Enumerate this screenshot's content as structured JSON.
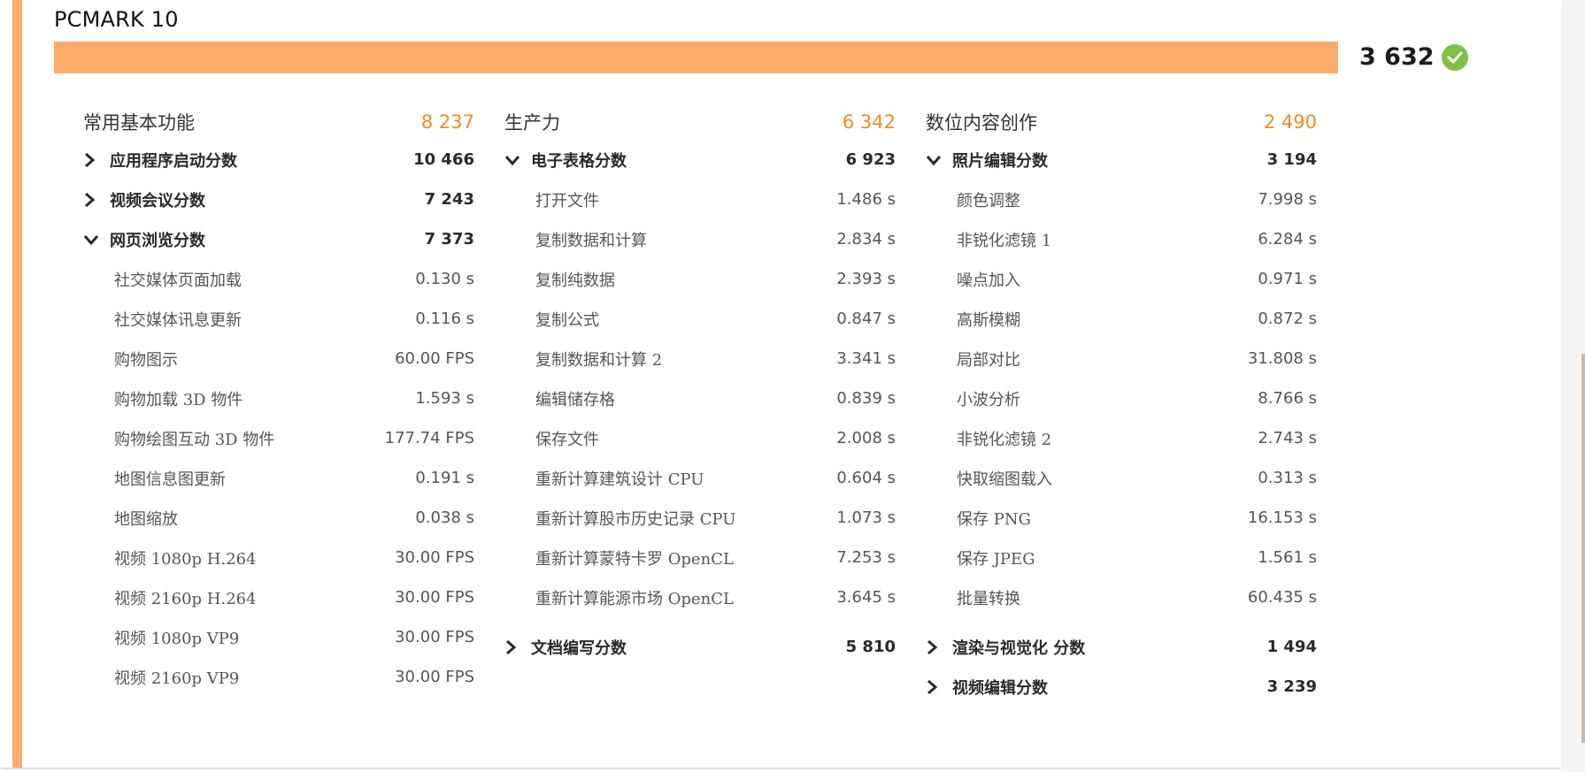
{
  "header": {
    "title": "PCMARK 10",
    "total_score": "3 632"
  },
  "colors": {
    "accent": "#ffac6a",
    "group_score": "#f08a24",
    "check": "#7fc142"
  },
  "groups": [
    {
      "name": "常用基本功能",
      "score": "8 237",
      "rows": [
        {
          "kind": "sub",
          "state": "collapsed",
          "name": "应用程序启动分数",
          "value": "10 466"
        },
        {
          "kind": "sub",
          "state": "collapsed",
          "name": "视频会议分数",
          "value": "7 243"
        },
        {
          "kind": "sub",
          "state": "expanded",
          "name": "网页浏览分数",
          "value": "7 373"
        },
        {
          "kind": "test",
          "name": "社交媒体页面加载",
          "value": "0.130 s"
        },
        {
          "kind": "test",
          "name": "社交媒体讯息更新",
          "value": "0.116 s"
        },
        {
          "kind": "test",
          "name": "购物图示",
          "value": "60.00 FPS"
        },
        {
          "kind": "test",
          "name": "购物加载 3D 物件",
          "value": "1.593 s"
        },
        {
          "kind": "test",
          "name": "购物绘图互动 3D 物件",
          "value": "177.74 FPS"
        },
        {
          "kind": "test",
          "name": "地图信息图更新",
          "value": "0.191 s"
        },
        {
          "kind": "test",
          "name": "地图缩放",
          "value": "0.038 s"
        },
        {
          "kind": "test",
          "name": "视频 1080p H.264",
          "value": "30.00 FPS"
        },
        {
          "kind": "test",
          "name": "视频 2160p H.264",
          "value": "30.00 FPS"
        },
        {
          "kind": "test",
          "name": "视频 1080p VP9",
          "value": "30.00 FPS"
        },
        {
          "kind": "test",
          "name": "视频 2160p VP9",
          "value": "30.00 FPS"
        }
      ]
    },
    {
      "name": "生产力",
      "score": "6 342",
      "rows": [
        {
          "kind": "sub",
          "state": "expanded",
          "name": "电子表格分数",
          "value": "6 923"
        },
        {
          "kind": "test",
          "name": "打开文件",
          "value": "1.486 s"
        },
        {
          "kind": "test",
          "name": "复制数据和计算",
          "value": "2.834 s"
        },
        {
          "kind": "test",
          "name": "复制纯数据",
          "value": "2.393 s"
        },
        {
          "kind": "test",
          "name": "复制公式",
          "value": "0.847 s"
        },
        {
          "kind": "test",
          "name": "复制数据和计算 2",
          "value": "3.341 s"
        },
        {
          "kind": "test",
          "name": "编辑储存格",
          "value": "0.839 s"
        },
        {
          "kind": "test",
          "name": "保存文件",
          "value": "2.008 s"
        },
        {
          "kind": "test",
          "name": "重新计算建筑设计 CPU",
          "value": "0.604 s"
        },
        {
          "kind": "test",
          "name": "重新计算股市历史记录 CPU",
          "value": "1.073 s"
        },
        {
          "kind": "test",
          "name": "重新计算蒙特卡罗 OpenCL",
          "value": "7.253 s"
        },
        {
          "kind": "test",
          "name": "重新计算能源市场 OpenCL",
          "value": "3.645 s"
        },
        {
          "kind": "sub",
          "state": "collapsed",
          "name": "文档编写分数",
          "value": "5 810",
          "gap": true
        }
      ]
    },
    {
      "name": "数位内容创作",
      "score": "2 490",
      "rows": [
        {
          "kind": "sub",
          "state": "expanded",
          "name": "照片编辑分数",
          "value": "3 194"
        },
        {
          "kind": "test",
          "name": "颜色调整",
          "value": "7.998 s"
        },
        {
          "kind": "test",
          "name": "非锐化滤镜 1",
          "value": "6.284 s"
        },
        {
          "kind": "test",
          "name": "噪点加入",
          "value": "0.971 s"
        },
        {
          "kind": "test",
          "name": "高斯模糊",
          "value": "0.872 s"
        },
        {
          "kind": "test",
          "name": "局部对比",
          "value": "31.808 s"
        },
        {
          "kind": "test",
          "name": "小波分析",
          "value": "8.766 s"
        },
        {
          "kind": "test",
          "name": "非锐化滤镜 2",
          "value": "2.743 s"
        },
        {
          "kind": "test",
          "name": "快取缩图载入",
          "value": "0.313 s"
        },
        {
          "kind": "test",
          "name": "保存 PNG",
          "value": "16.153 s"
        },
        {
          "kind": "test",
          "name": "保存 JPEG",
          "value": "1.561 s"
        },
        {
          "kind": "test",
          "name": "批量转换",
          "value": "60.435 s"
        },
        {
          "kind": "sub",
          "state": "collapsed",
          "name": "渲染与视觉化 分数",
          "value": "1 494",
          "gap": true
        },
        {
          "kind": "sub",
          "state": "collapsed",
          "name": "视频编辑分数",
          "value": "3 239"
        }
      ]
    }
  ]
}
